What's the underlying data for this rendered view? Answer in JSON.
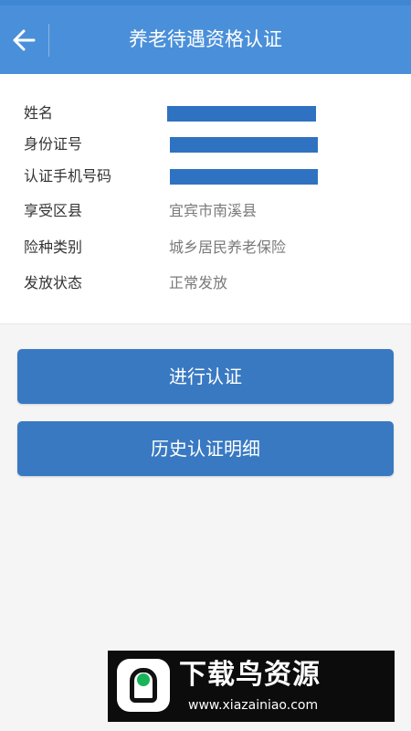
{
  "header": {
    "title": "养老待遇资格认证",
    "back_icon": "arrow-left-icon"
  },
  "info": {
    "rows": [
      {
        "label": "姓名",
        "value": "",
        "redacted": true
      },
      {
        "label": "身份证号",
        "value": "",
        "redacted": true
      },
      {
        "label": "认证手机号码",
        "value": "",
        "redacted": true
      },
      {
        "label": "享受区县",
        "value": "宜宾市南溪县",
        "redacted": false
      },
      {
        "label": "险种类别",
        "value": "城乡居民养老保险",
        "redacted": false
      },
      {
        "label": "发放状态",
        "value": "正常发放",
        "redacted": false
      }
    ]
  },
  "actions": {
    "verify_label": "进行认证",
    "history_label": "历史认证明细"
  },
  "watermark": {
    "name": "下载鸟资源",
    "url": "www.xiazainiao.com"
  },
  "colors": {
    "header": "#4a8fd9",
    "button": "#3979c2",
    "redaction": "#2f72c1"
  }
}
